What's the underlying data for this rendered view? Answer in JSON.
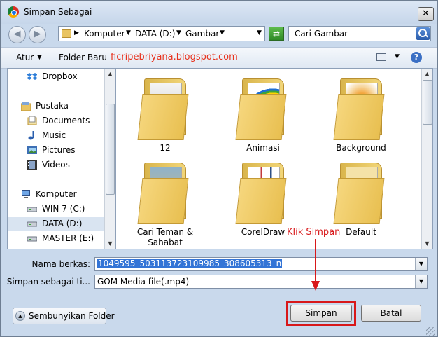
{
  "window": {
    "title": "Simpan Sebagai"
  },
  "nav": {
    "breadcrumb": [
      "Komputer",
      "DATA (D:)",
      "Gambar"
    ],
    "search_placeholder": "Cari Gambar"
  },
  "toolbar": {
    "organize_label": "Atur",
    "new_folder_label": "Folder Baru",
    "watermark": "ficripebriyana.blogspot.com"
  },
  "sidebar": {
    "items": [
      {
        "label": "Dropbox",
        "icon": "dropbox-icon"
      },
      {
        "label": "Pustaka",
        "icon": "library-icon"
      },
      {
        "label": "Documents",
        "icon": "documents-icon"
      },
      {
        "label": "Music",
        "icon": "music-icon"
      },
      {
        "label": "Pictures",
        "icon": "pictures-icon"
      },
      {
        "label": "Videos",
        "icon": "videos-icon"
      },
      {
        "label": "Komputer",
        "icon": "computer-icon"
      },
      {
        "label": "WIN 7 (C:)",
        "icon": "drive-icon"
      },
      {
        "label": "DATA (D:)",
        "icon": "drive-icon"
      },
      {
        "label": "MASTER (E:)",
        "icon": "drive-icon"
      }
    ]
  },
  "folders": [
    {
      "name": "12"
    },
    {
      "name": "Animasi"
    },
    {
      "name": "Background"
    },
    {
      "name": "Cari Teman & Sahabat"
    },
    {
      "name": "CorelDraw"
    },
    {
      "name": "Default"
    }
  ],
  "form": {
    "filename_label": "Nama berkas:",
    "filename_value": "1049595_503113723109985_308605313_n",
    "savetype_label": "Simpan sebagai ti...",
    "savetype_value": "GOM Media file(.mp4)"
  },
  "buttons": {
    "hide_folders": "Sembunyikan Folder",
    "save": "Simpan",
    "cancel": "Batal"
  },
  "annotation": {
    "text": "Klik Simpan",
    "color": "#d8181a"
  }
}
